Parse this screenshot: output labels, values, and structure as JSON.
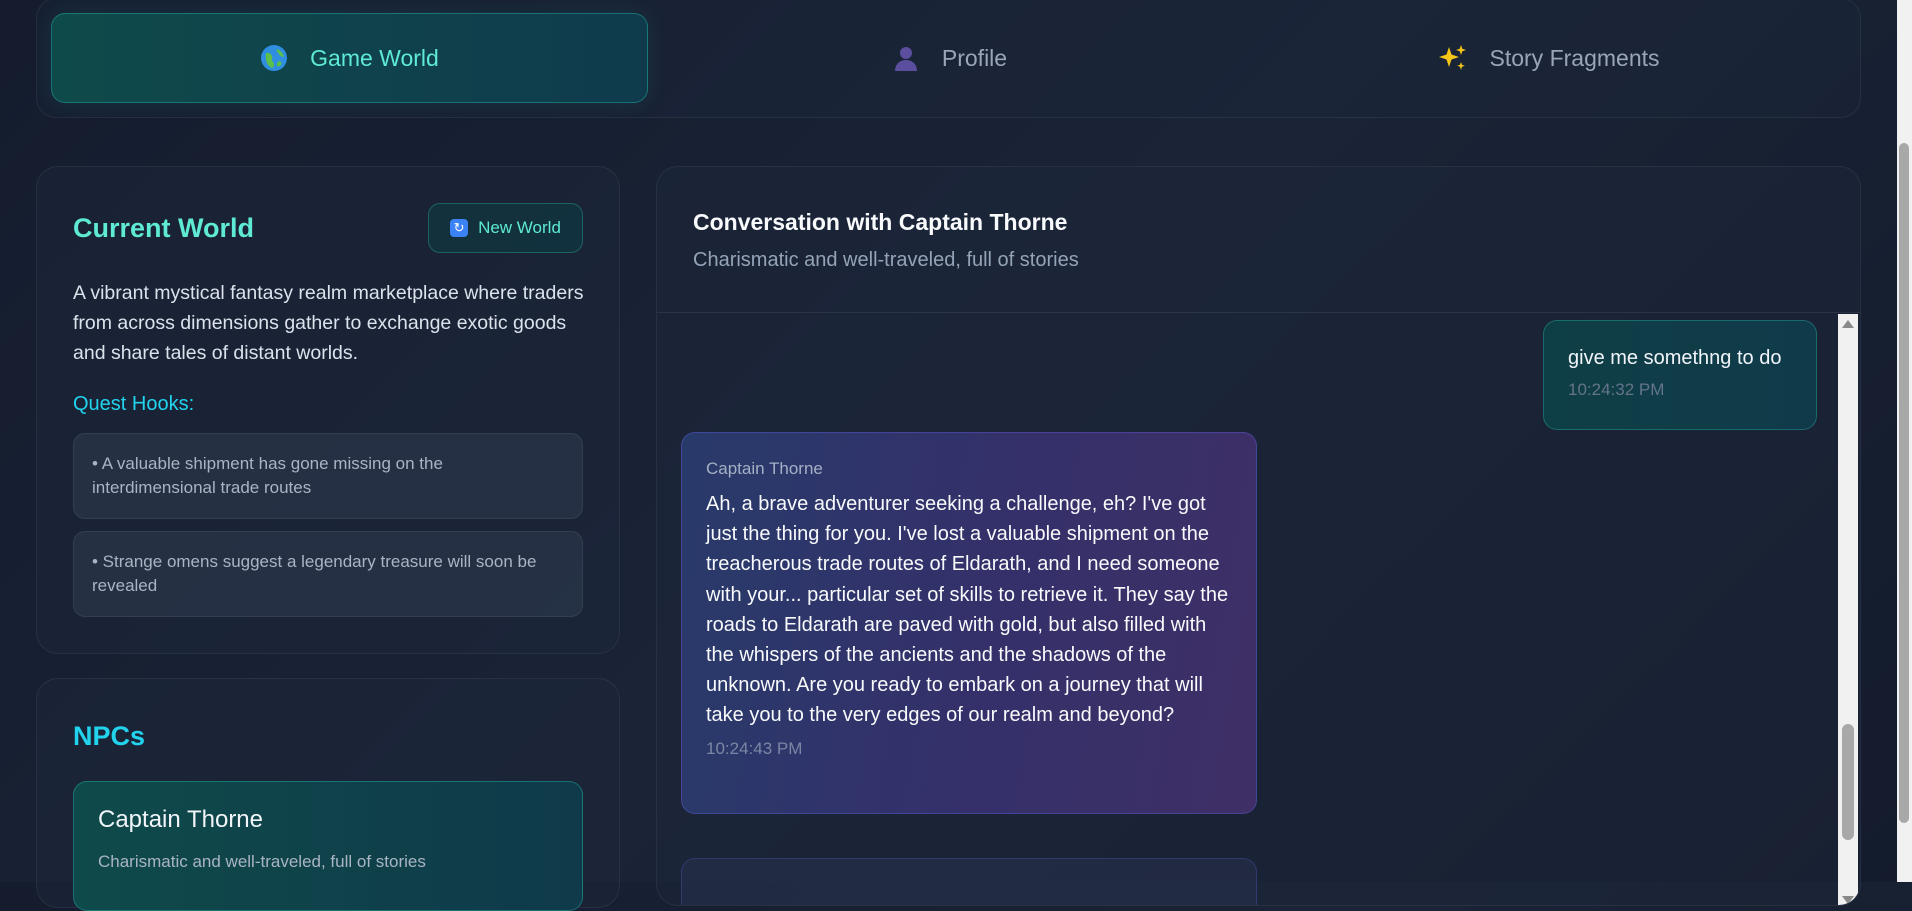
{
  "tabs": [
    {
      "label": "Game World",
      "icon": "globe-icon",
      "active": true
    },
    {
      "label": "Profile",
      "icon": "user-silhouette-icon",
      "active": false
    },
    {
      "label": "Story Fragments",
      "icon": "sparkles-icon",
      "active": false
    }
  ],
  "world": {
    "title": "Current World",
    "new_world_label": "New World",
    "description": "A vibrant mystical fantasy realm marketplace where traders from across dimensions gather to exchange exotic goods and share tales of distant worlds.",
    "quest_heading": "Quest Hooks:",
    "quest_hooks": [
      "• A valuable shipment has gone missing on the interdimensional trade routes",
      "• Strange omens suggest a legendary treasure will soon be revealed"
    ]
  },
  "npcs": {
    "title": "NPCs",
    "items": [
      {
        "name": "Captain Thorne",
        "description": "Charismatic and well-traveled, full of stories"
      }
    ]
  },
  "conversation": {
    "title": "Conversation with Captain Thorne",
    "subtitle": "Charismatic and well-traveled, full of stories",
    "messages": [
      {
        "role": "user",
        "text": "give me somethng to do",
        "time": "10:24:32 PM"
      },
      {
        "role": "npc",
        "sender": "Captain Thorne",
        "text": "Ah, a brave adventurer seeking a challenge, eh? I've got just the thing for you. I've lost a valuable shipment on the treacherous trade routes of Eldarath, and I need someone with your... particular set of skills to retrieve it. They say the roads to Eldarath are paved with gold, but also filled with the whispers of the ancients and the shadows of the unknown. Are you ready to embark on a journey that will take you to the very edges of our realm and beyond?",
        "time": "10:24:43 PM"
      }
    ]
  },
  "colors": {
    "accent_teal": "#5eead4",
    "accent_cyan": "#22d3ee",
    "background": "#141c2e"
  }
}
